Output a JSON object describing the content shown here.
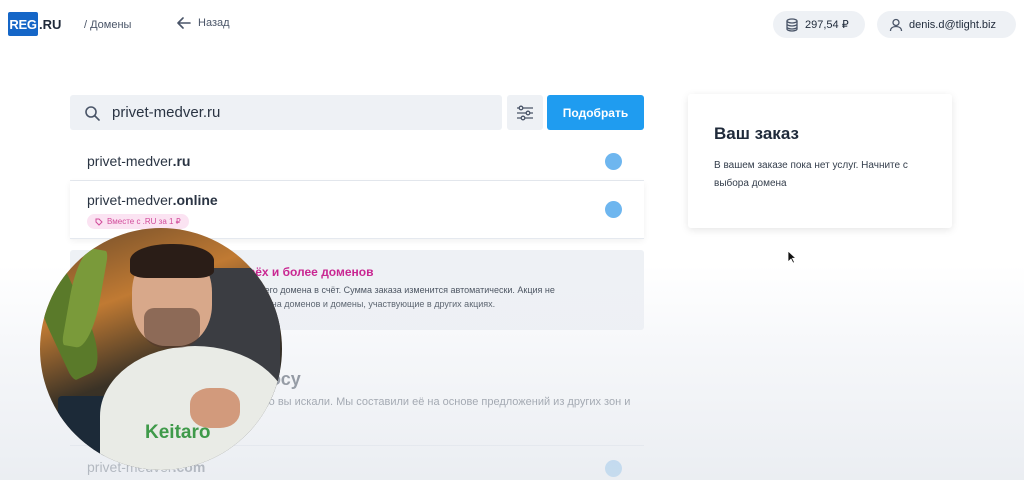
{
  "header": {
    "logo_box": "REG",
    "logo_suffix": ".RU",
    "breadcrumb": "/ Домены",
    "back_label": "Назад",
    "balance": "297,54 ₽",
    "user_email": "denis.d@tlight.biz"
  },
  "search": {
    "query": "privet-medver.ru",
    "submit_label": "Подобрать"
  },
  "results": [
    {
      "name": "privet-medver",
      "zone": ".ru"
    },
    {
      "name": "privet-medver",
      "zone": ".online",
      "tag": "Вместе с .RU за 1 ₽"
    }
  ],
  "promo": {
    "title": "трёх и более доменов",
    "text": "третьего домена в счёт. Сумма заказа изменится автоматически. Акция не\nМагазина доменов и домены, участвующие в других акциях."
  },
  "suggestions": {
    "title": "осу",
    "text": "что вы искали. Мы составили её на основе предложений из других зон и",
    "row": {
      "name": "privet-medver",
      "zone": ".com"
    }
  },
  "order": {
    "title": "Ваш заказ",
    "text": "В вашем заказе пока нет услуг. Начните с выбора домена"
  },
  "overlay": {
    "brand": "Keitaro"
  },
  "colors": {
    "accent": "#1f9cf0",
    "logo": "#1566c7",
    "promo_title": "#c71d8d",
    "availability_dot": "#6eb6ef"
  }
}
